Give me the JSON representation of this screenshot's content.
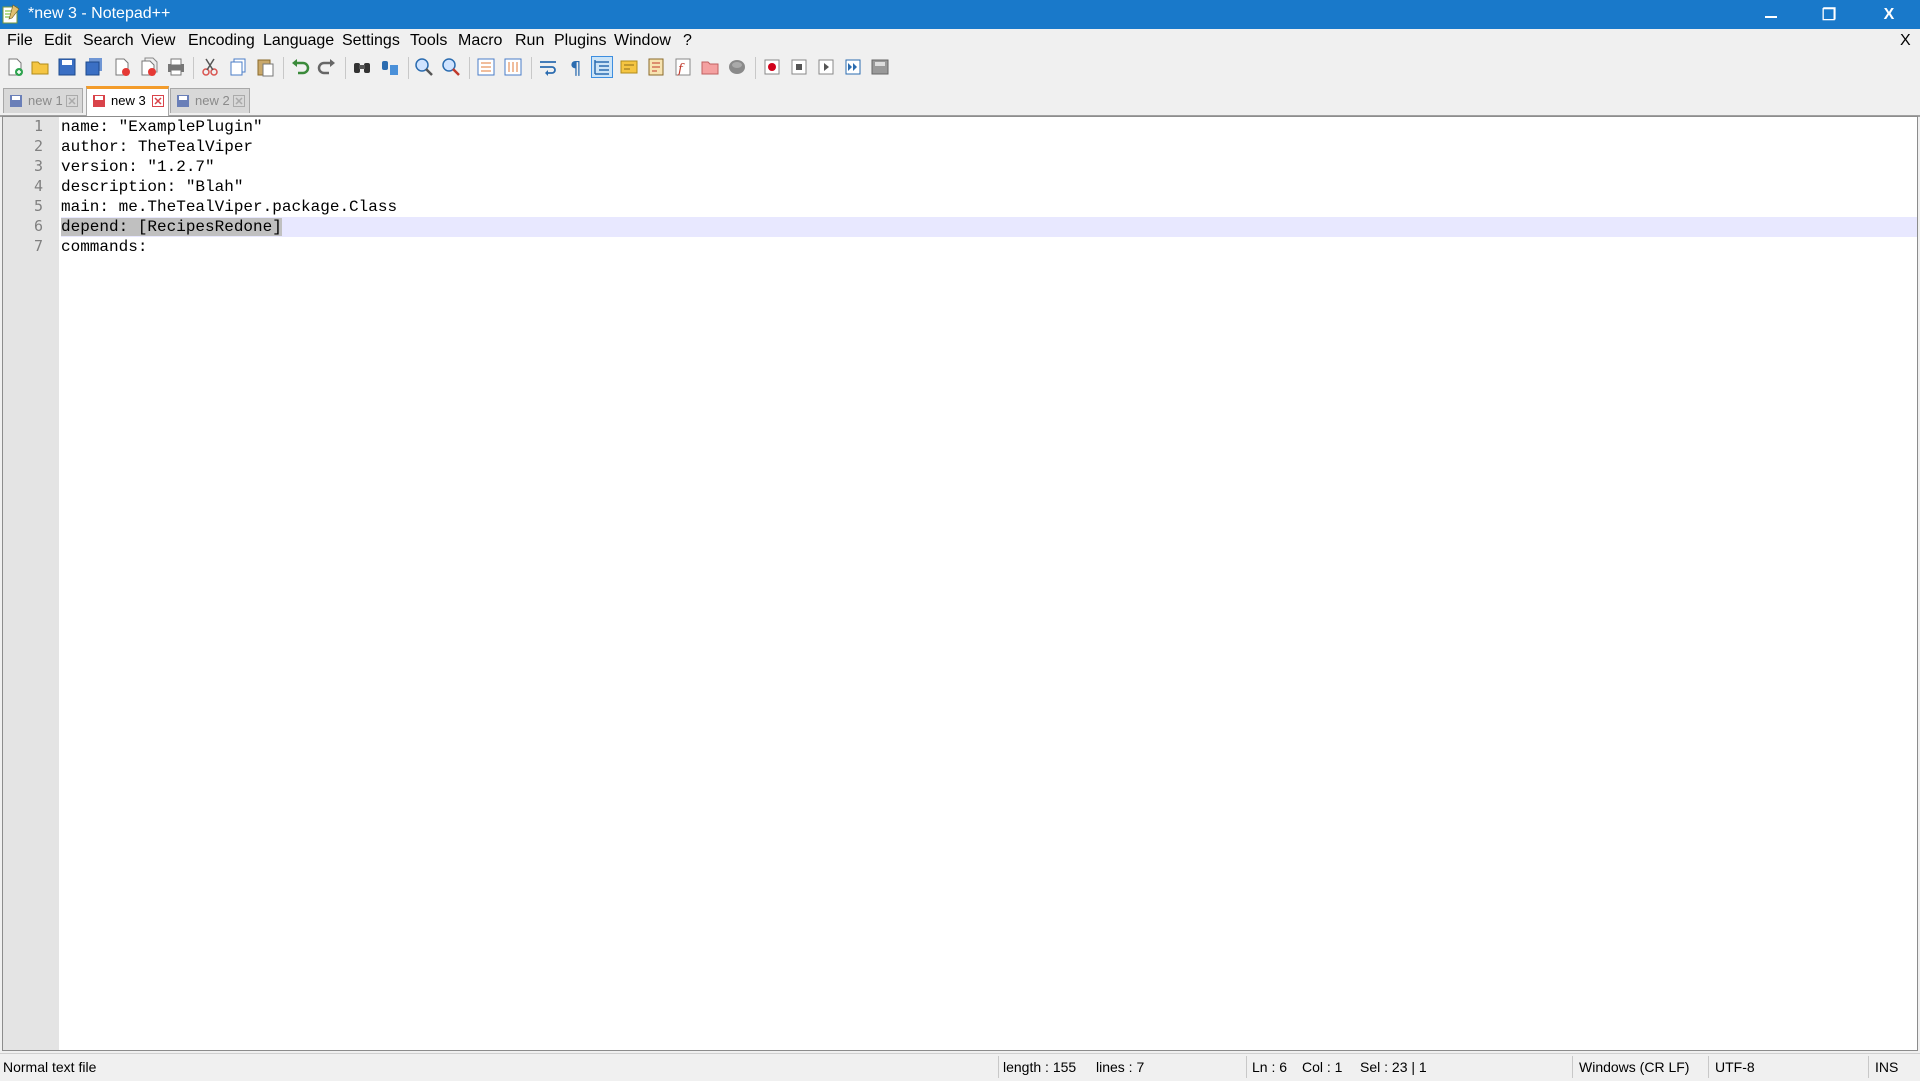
{
  "window": {
    "title": "*new 3 - Notepad++",
    "maximize_glyph": "❐",
    "close_glyph": "X"
  },
  "menu": {
    "items": [
      {
        "label": "File"
      },
      {
        "label": "Edit"
      },
      {
        "label": "Search"
      },
      {
        "label": "View"
      },
      {
        "label": "Encoding"
      },
      {
        "label": "Language"
      },
      {
        "label": "Settings"
      },
      {
        "label": "Tools"
      },
      {
        "label": "Macro"
      },
      {
        "label": "Run"
      },
      {
        "label": "Plugins"
      },
      {
        "label": "Window"
      },
      {
        "label": "?"
      }
    ],
    "close_label": "X"
  },
  "tabs": [
    {
      "label": "new 1",
      "active": false
    },
    {
      "label": "new 3",
      "active": true
    },
    {
      "label": "new 2",
      "active": false
    }
  ],
  "editor": {
    "line_numbers": [
      "1",
      "2",
      "3",
      "4",
      "5",
      "6",
      "7"
    ],
    "lines": [
      "name: \"ExamplePlugin\"",
      "author: TheTealViper",
      "version: \"1.2.7\"",
      "description: \"Blah\"",
      "main: me.TheTealViper.package.Class",
      "depend: [RecipesRedone]",
      "commands:"
    ],
    "current_line": 6
  },
  "status": {
    "file_type": "Normal text file",
    "length": "length : 155",
    "lines": "lines : 7",
    "ln": "Ln : 6",
    "col": "Col : 1",
    "sel": "Sel : 23 | 1",
    "eol": "Windows (CR LF)",
    "encoding": "UTF-8",
    "mode": "INS"
  },
  "colors": {
    "titlebar": "#1979ca",
    "active_tab_accent": "#f39c2b",
    "current_line": "#e8e8ff",
    "selection": "#c0c0c0"
  }
}
